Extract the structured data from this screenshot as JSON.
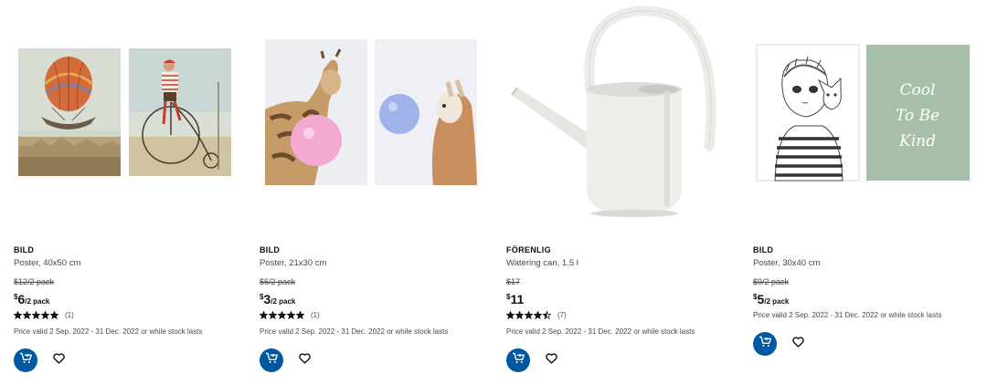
{
  "products": [
    {
      "brand": "BILD",
      "description": "Poster, 40x50 cm",
      "old_price": "$12/2 pack",
      "currency": "$",
      "price": "6",
      "unit": "/2 pack",
      "rating_value": 5,
      "rating_count": "(1)",
      "validity": "Price valid 2 Sep. 2022 - 31 Dec. 2022 or while stock lasts"
    },
    {
      "brand": "BILD",
      "description": "Poster, 21x30 cm",
      "old_price": "$6/2 pack",
      "currency": "$",
      "price": "3",
      "unit": "/2 pack",
      "rating_value": 5,
      "rating_count": "(1)",
      "validity": "Price valid 2 Sep. 2022 - 31 Dec. 2022 or while stock lasts"
    },
    {
      "brand": "FÖRENLIG",
      "description": "Watering can, 1.5 l",
      "old_price": "$17",
      "currency": "$",
      "price": "11",
      "unit": "",
      "rating_value": 4.5,
      "rating_count": "(7)",
      "validity": "Price valid 2 Sep. 2022 - 31 Dec. 2022 or while stock lasts"
    },
    {
      "brand": "BILD",
      "description": "Poster, 30x40 cm",
      "old_price": "$9/2 pack",
      "currency": "$",
      "price": "5",
      "unit": "/2 pack",
      "validity": "Price valid 2 Sep. 2022 - 31 Dec. 2022 or while stock lasts"
    }
  ],
  "poster_script": [
    "Cool",
    "To Be",
    "Kind"
  ],
  "icons": {
    "cart": "add-to-cart-icon",
    "favourite": "heart-icon",
    "star": "star-icon"
  },
  "colors": {
    "cart_button": "#0058a3",
    "text": "#111111",
    "muted_text": "#484848",
    "sage_poster": "#a7bfa8"
  }
}
